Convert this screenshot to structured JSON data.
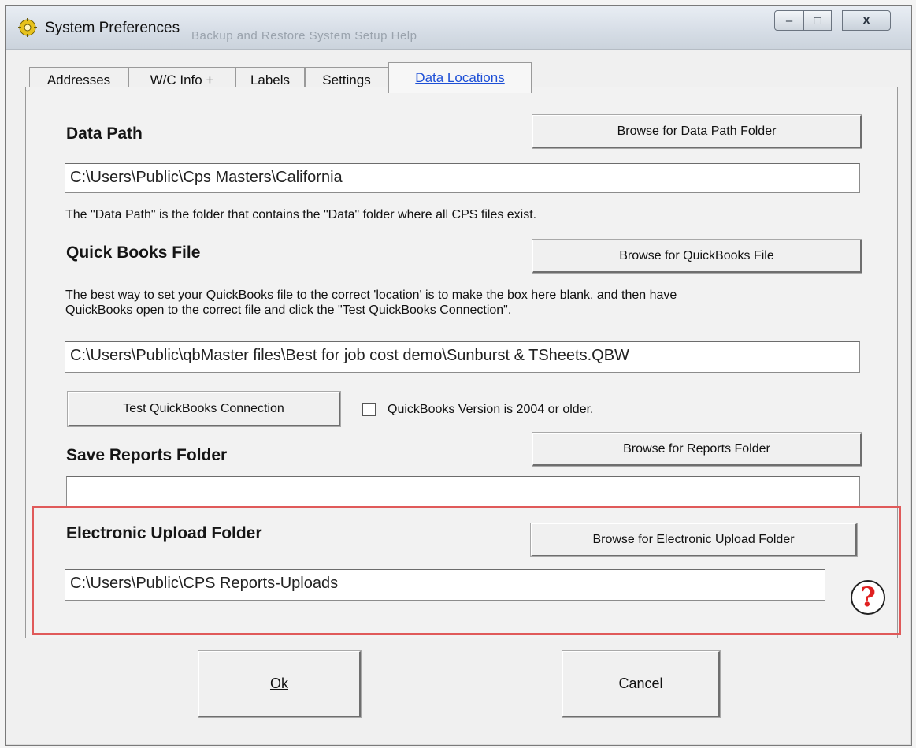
{
  "window": {
    "title": "System Preferences",
    "background_menu_ghost": "Backup and Restore   System Setup   Help",
    "min_label": "–",
    "max_label": "□",
    "close_label": "X"
  },
  "tabs": [
    {
      "label": "Addresses",
      "active": false
    },
    {
      "label": "W/C Info +",
      "active": false
    },
    {
      "label": "Labels",
      "active": false
    },
    {
      "label": "Settings",
      "active": false
    },
    {
      "label": "Data Locations",
      "active": true
    }
  ],
  "data_path": {
    "heading": "Data Path",
    "browse_label": "Browse for Data Path Folder",
    "value": "C:\\Users\\Public\\Cps Masters\\California",
    "description": "The \"Data Path\" is the folder that contains the \"Data\" folder where all CPS files exist."
  },
  "quickbooks": {
    "heading": "Quick Books File",
    "browse_label": "Browse for QuickBooks File",
    "description_line1": "The best way to set your QuickBooks file to the correct 'location' is to make the box here blank, and then have",
    "description_line2": "QuickBooks open to the correct file and click the \"Test QuickBooks Connection\".",
    "value": "C:\\Users\\Public\\qbMaster files\\Best for job cost demo\\Sunburst & TSheets.QBW",
    "test_label": "Test QuickBooks Connection",
    "version_checkbox_label": "QuickBooks Version is 2004 or older.",
    "version_checked": false
  },
  "reports": {
    "heading": "Save Reports Folder",
    "browse_label": "Browse for Reports Folder",
    "value": ""
  },
  "upload": {
    "heading": "Electronic Upload Folder",
    "browse_label": "Browse for Electronic Upload Folder",
    "value": "C:\\Users\\Public\\CPS Reports-Uploads",
    "help_glyph": "?"
  },
  "footer": {
    "ok_label": "Ok",
    "cancel_label": "Cancel"
  },
  "colors": {
    "active_tab_text": "#1d4fd6",
    "highlight_border": "#e05a5a",
    "help_mark": "#e02020"
  }
}
